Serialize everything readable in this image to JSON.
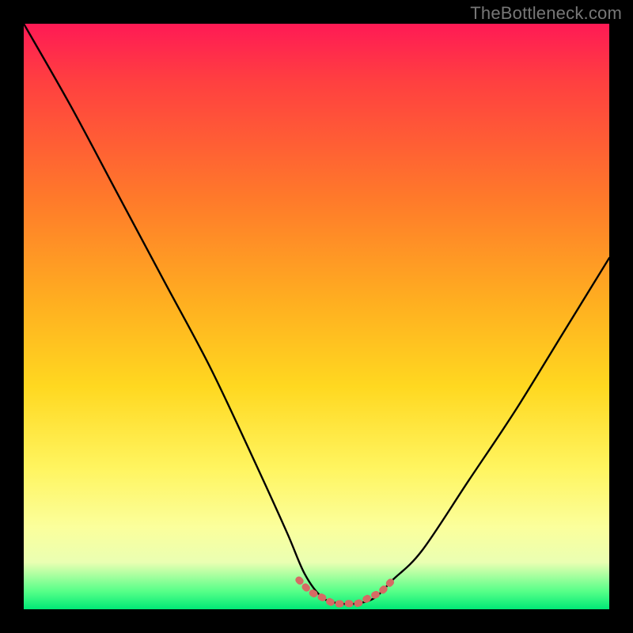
{
  "watermark": "TheBottleneck.com",
  "colors": {
    "black_frame": "#000000",
    "curve": "#000000",
    "valley_line": "#d66a64",
    "gradient_top": "#ff1a55",
    "gradient_mid": "#ffd820",
    "gradient_bottom": "#00e876"
  },
  "chart_data": {
    "type": "line",
    "title": "",
    "xlabel": "",
    "ylabel": "",
    "xlim": [
      0,
      100
    ],
    "ylim": [
      0,
      100
    ],
    "grid": false,
    "legend": false,
    "annotations": [
      "TheBottleneck.com"
    ],
    "series": [
      {
        "name": "bottleneck-curve",
        "x": [
          0,
          8,
          16,
          24,
          32,
          40,
          45,
          48,
          51,
          54,
          57,
          60,
          63,
          68,
          76,
          84,
          92,
          100
        ],
        "values": [
          100,
          86,
          71,
          56,
          41,
          24,
          13,
          6,
          2,
          1,
          1,
          2,
          5,
          10,
          22,
          34,
          47,
          60
        ]
      },
      {
        "name": "valley-highlight",
        "x": [
          47,
          49,
          51,
          53,
          55,
          57,
          59,
          61,
          63
        ],
        "values": [
          5,
          3,
          2,
          1,
          1,
          1,
          2,
          3,
          5
        ]
      }
    ]
  }
}
